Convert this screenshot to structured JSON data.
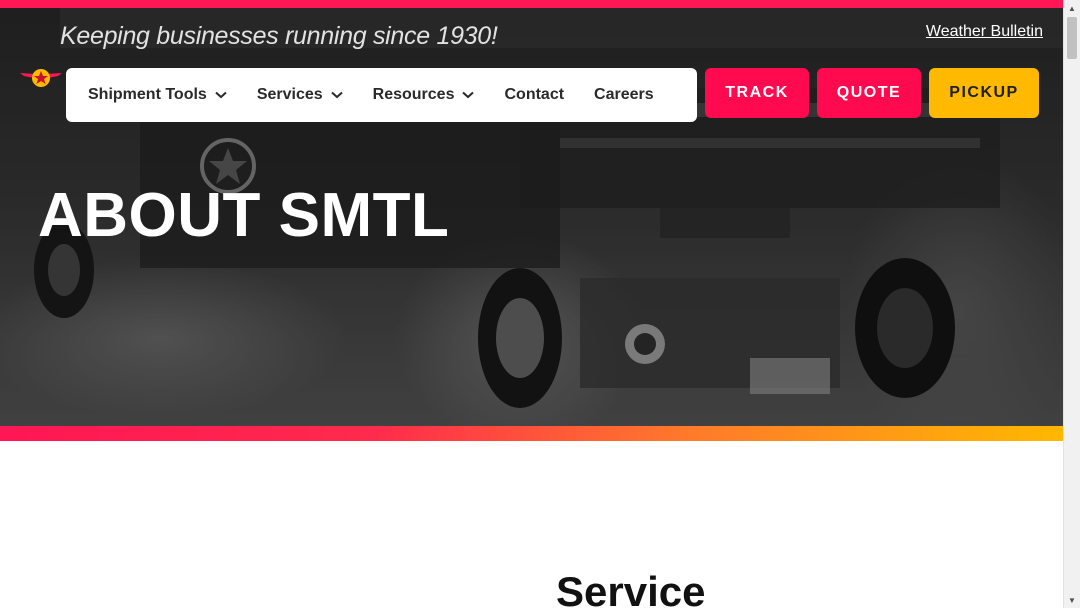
{
  "header": {
    "tagline": "Keeping businesses running since 1930!",
    "weather_link": "Weather Bulletin"
  },
  "nav": {
    "items": [
      {
        "label": "Shipment Tools",
        "has_dropdown": true
      },
      {
        "label": "Services",
        "has_dropdown": true
      },
      {
        "label": "Resources",
        "has_dropdown": true
      },
      {
        "label": "Contact",
        "has_dropdown": false
      },
      {
        "label": "Careers",
        "has_dropdown": false
      }
    ]
  },
  "cta": {
    "track": "TRACK",
    "quote": "QUOTE",
    "pickup": "PICKUP"
  },
  "hero": {
    "title": "ABOUT SMTL"
  },
  "section": {
    "heading": "Service"
  },
  "colors": {
    "brand_red": "#ff0a4e",
    "brand_yellow": "#ffb900",
    "gradient_start": "#ff1654",
    "gradient_end": "#ffb800"
  },
  "icons": {
    "logo": "winged-star-logo",
    "dropdown": "chevron-down-icon"
  }
}
